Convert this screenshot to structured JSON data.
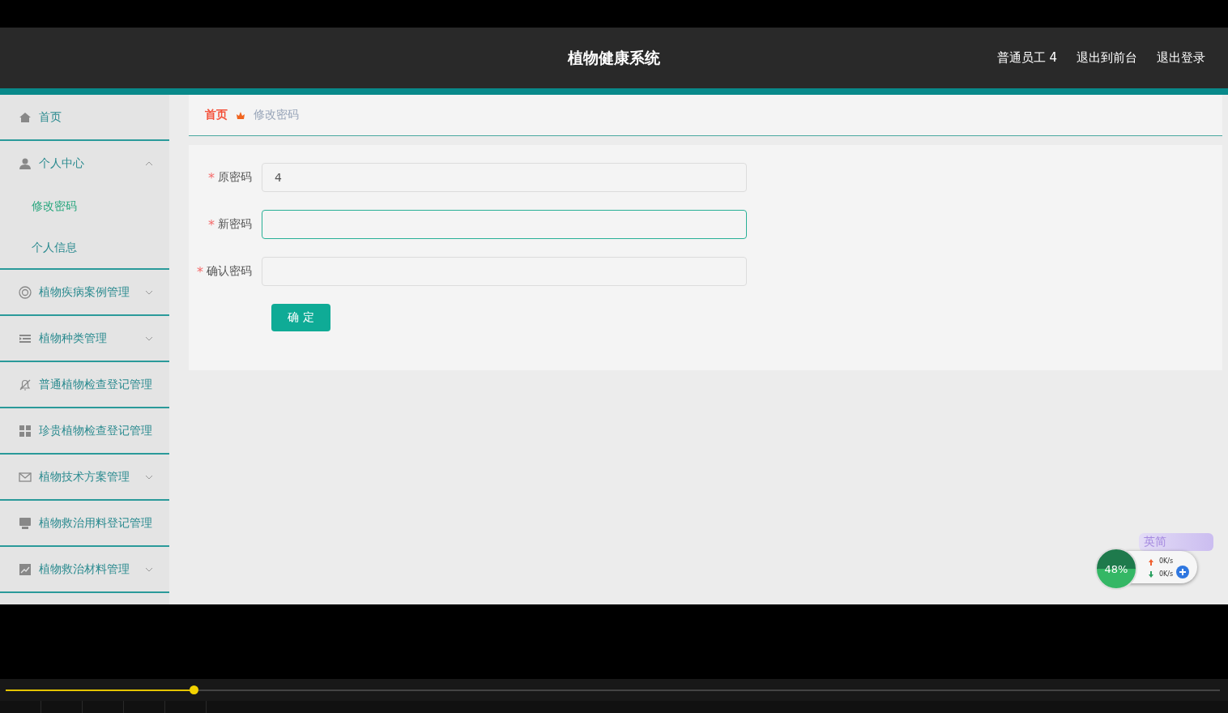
{
  "header": {
    "title": "植物健康系统",
    "links": [
      "普通员工 4",
      "退出到前台",
      "退出登录"
    ]
  },
  "sidebar": {
    "items": [
      {
        "label": "首页"
      },
      {
        "label": "个人中心",
        "expanded": true,
        "children": [
          {
            "label": "修改密码",
            "selected": true
          },
          {
            "label": "个人信息",
            "selected": false
          }
        ]
      },
      {
        "label": "植物疾病案例管理",
        "expanded": false
      },
      {
        "label": "植物种类管理",
        "expanded": false
      },
      {
        "label": "普通植物检查登记管理"
      },
      {
        "label": "珍贵植物检查登记管理"
      },
      {
        "label": "植物技术方案管理",
        "expanded": false
      },
      {
        "label": "植物救治用料登记管理"
      },
      {
        "label": "植物救治材料管理",
        "expanded": false
      }
    ]
  },
  "breadcrumb": {
    "home": "首页",
    "current": "修改密码"
  },
  "form": {
    "fields": [
      {
        "label": "原密码",
        "required_mark": "*",
        "value": "4",
        "focused": false
      },
      {
        "label": "新密码",
        "required_mark": "*",
        "focused": true
      },
      {
        "label": "确认密码",
        "required_mark": "*",
        "focused": false
      }
    ],
    "submit": "确 定"
  },
  "net_widget": {
    "percent": "48%",
    "up": "0K/s",
    "down": "0K/s",
    "ime": "英简"
  }
}
